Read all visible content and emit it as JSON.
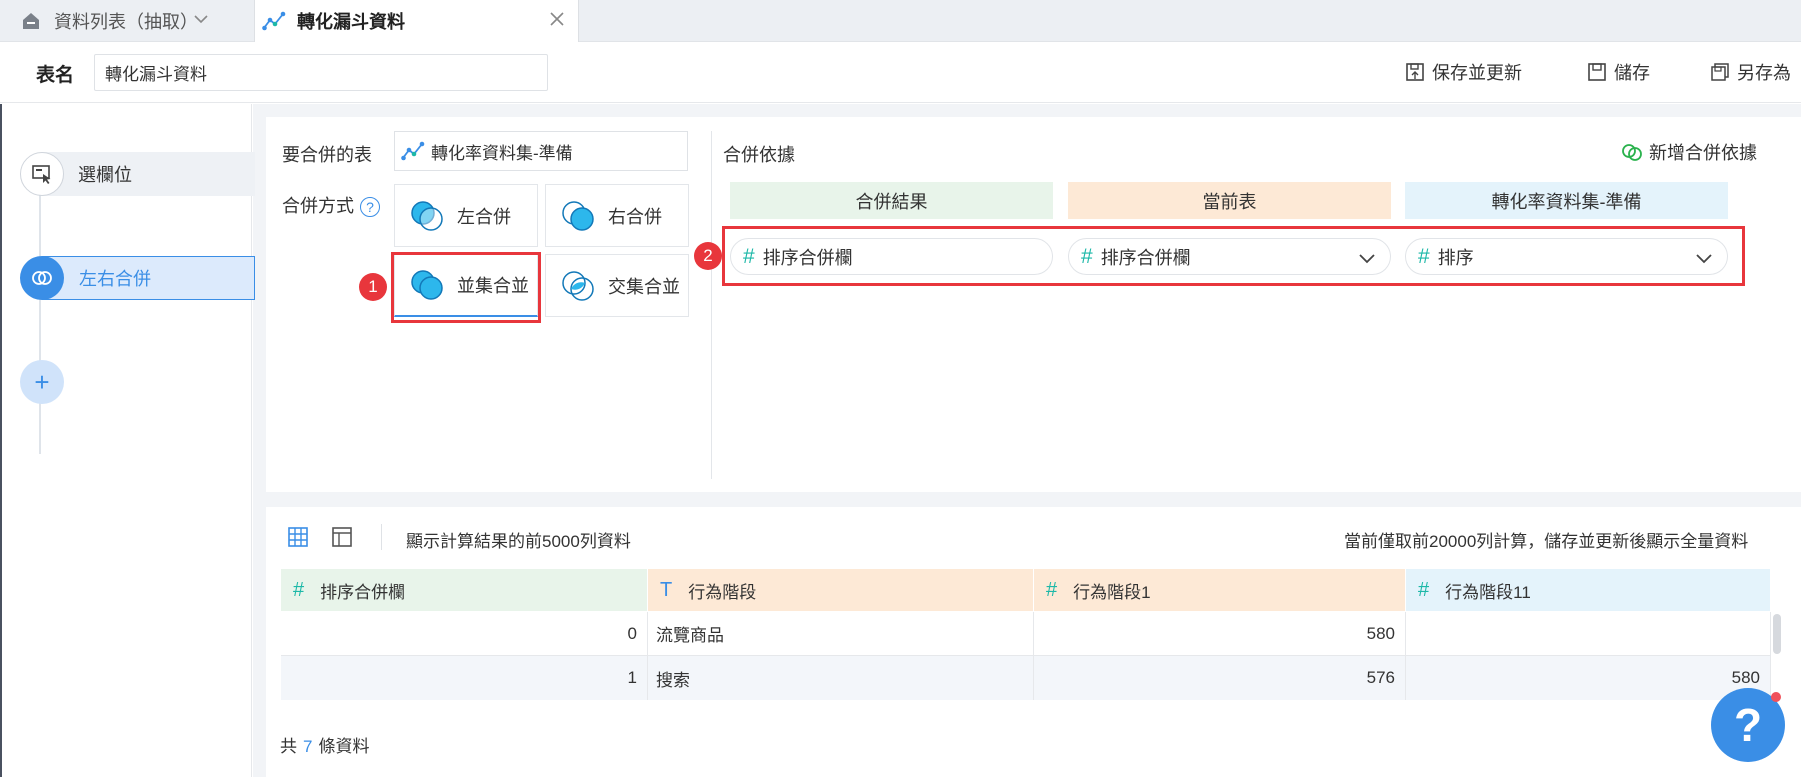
{
  "tabs": [
    {
      "label": "資料列表（抽取）"
    },
    {
      "label": "轉化漏斗資料"
    }
  ],
  "header": {
    "name_label": "表名",
    "name_value": "轉化漏斗資料",
    "save_update": "保存並更新",
    "save": "儲存",
    "save_as": "另存為"
  },
  "steps": [
    {
      "label": "選欄位"
    },
    {
      "label": "左右合併"
    },
    {
      "label": "+"
    }
  ],
  "config": {
    "table_label": "要合併的表",
    "table_value": "轉化率資料集-準備",
    "method_label": "合併方式",
    "help": "?",
    "methods": [
      {
        "label": "左合併"
      },
      {
        "label": "右合併"
      },
      {
        "label": "並集合並"
      },
      {
        "label": "交集合並"
      }
    ],
    "basis_label": "合併依據",
    "add_basis": "新增合併依據",
    "columns": [
      "合併結果",
      "當前表",
      "轉化率資料集-準備"
    ],
    "row": [
      "排序合併欄",
      "排序合併欄",
      "排序"
    ],
    "badges": [
      "1",
      "2"
    ]
  },
  "preview": {
    "note": "顯示計算結果的前5000列資料",
    "note_right": "當前僅取前20000列計算，儲存並更新後顯示全量資料",
    "headers": [
      {
        "type": "#",
        "label": "排序合併欄"
      },
      {
        "type": "T",
        "label": "行為階段"
      },
      {
        "type": "#",
        "label": "行為階段1"
      },
      {
        "type": "#",
        "label": "行為階段11"
      }
    ],
    "rows": [
      [
        "0",
        "流覽商品",
        "580",
        ""
      ],
      [
        "1",
        "搜索",
        "576",
        "580"
      ]
    ],
    "total_prefix": "共",
    "total_count": "7",
    "total_suffix": "條資料"
  },
  "help_fab": "?",
  "colors": {
    "accent": "#3a8ee6",
    "red": "#e8363c",
    "teal": "#1db8a8",
    "result_header": "#e8f4ea",
    "current_header": "#fde9d6",
    "other_header": "#e4f3fb"
  }
}
